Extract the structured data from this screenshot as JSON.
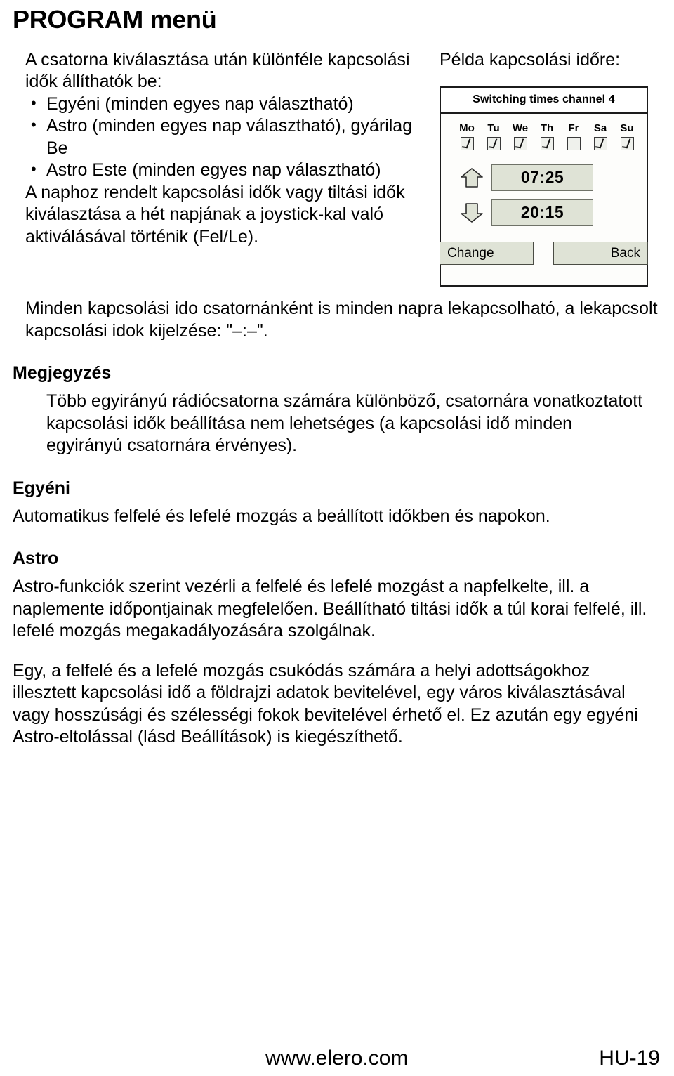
{
  "page": {
    "title": "PROGRAM menü"
  },
  "intro": {
    "lead": "A csatorna kiválasztása után különféle kapcsolási idők állíthatók be:",
    "bullets": [
      "Egyéni (minden egyes nap választható)",
      "Astro (minden egyes nap választható), gyárilag Be",
      "Astro Este (minden egyes nap választható)"
    ],
    "after_bullets": "A naphoz rendelt kapcsolási idők vagy tiltási idők kiválasztása a hét napjának a joystick-kal való aktiválásával történik (Fel/Le)."
  },
  "example": {
    "label": "Példa kapcsolási időre:",
    "device": {
      "title": "Switching times channel 4",
      "days": [
        {
          "label": "Mo",
          "checked": true
        },
        {
          "label": "Tu",
          "checked": true
        },
        {
          "label": "We",
          "checked": true
        },
        {
          "label": "Th",
          "checked": true
        },
        {
          "label": "Fr",
          "checked": false
        },
        {
          "label": "Sa",
          "checked": true
        },
        {
          "label": "Su",
          "checked": true
        }
      ],
      "up_time": "07:25",
      "down_time": "20:15",
      "softkey_left": "Change",
      "softkey_right": "Back",
      "up_icon": "arrow-up-icon",
      "down_icon": "arrow-down-icon",
      "box_color": "#dfe3d6",
      "border_color": "#1b1b1b"
    }
  },
  "note_after_device": "Minden kapcsolási ido csatornánként is minden napra lekapcsolható, a lekapcsolt kapcsolási idok kijelzése: \"–:–\".",
  "sections": [
    {
      "heading": "Megjegyzés",
      "body": "Több egyirányú rádiócsatorna számára különböző, csatornára vonatkoztatott kapcsolási idők beállítása nem lehetséges (a kapcsolási idő minden egyirányú csatornára érvényes)."
    },
    {
      "heading": "Egyéni",
      "body": "Automatikus felfelé és lefelé mozgás a beállított időkben és napokon."
    },
    {
      "heading": "Astro",
      "body": "Astro-funkciók szerint vezérli a felfelé és lefelé mozgást a napfelkelte, ill. a naplemente időpontjainak megfelelően. Beállítható tiltási idők a túl korai felfelé, ill. lefelé mozgás megakadályozására szolgálnak.",
      "body2": "Egy, a felfelé és a lefelé mozgás csukódás számára a helyi adottságokhoz illesztett kapcsolási idő a földrajzi adatok bevitelével, egy város kiválasztásával vagy hosszúsági és szélességi fokok bevitelével érhető el. Ez azután egy egyéni Astro-eltolással (lásd Beállítások) is kiegészíthető."
    }
  ],
  "footer": {
    "url": "www.elero.com",
    "page_ref": "HU-19"
  }
}
